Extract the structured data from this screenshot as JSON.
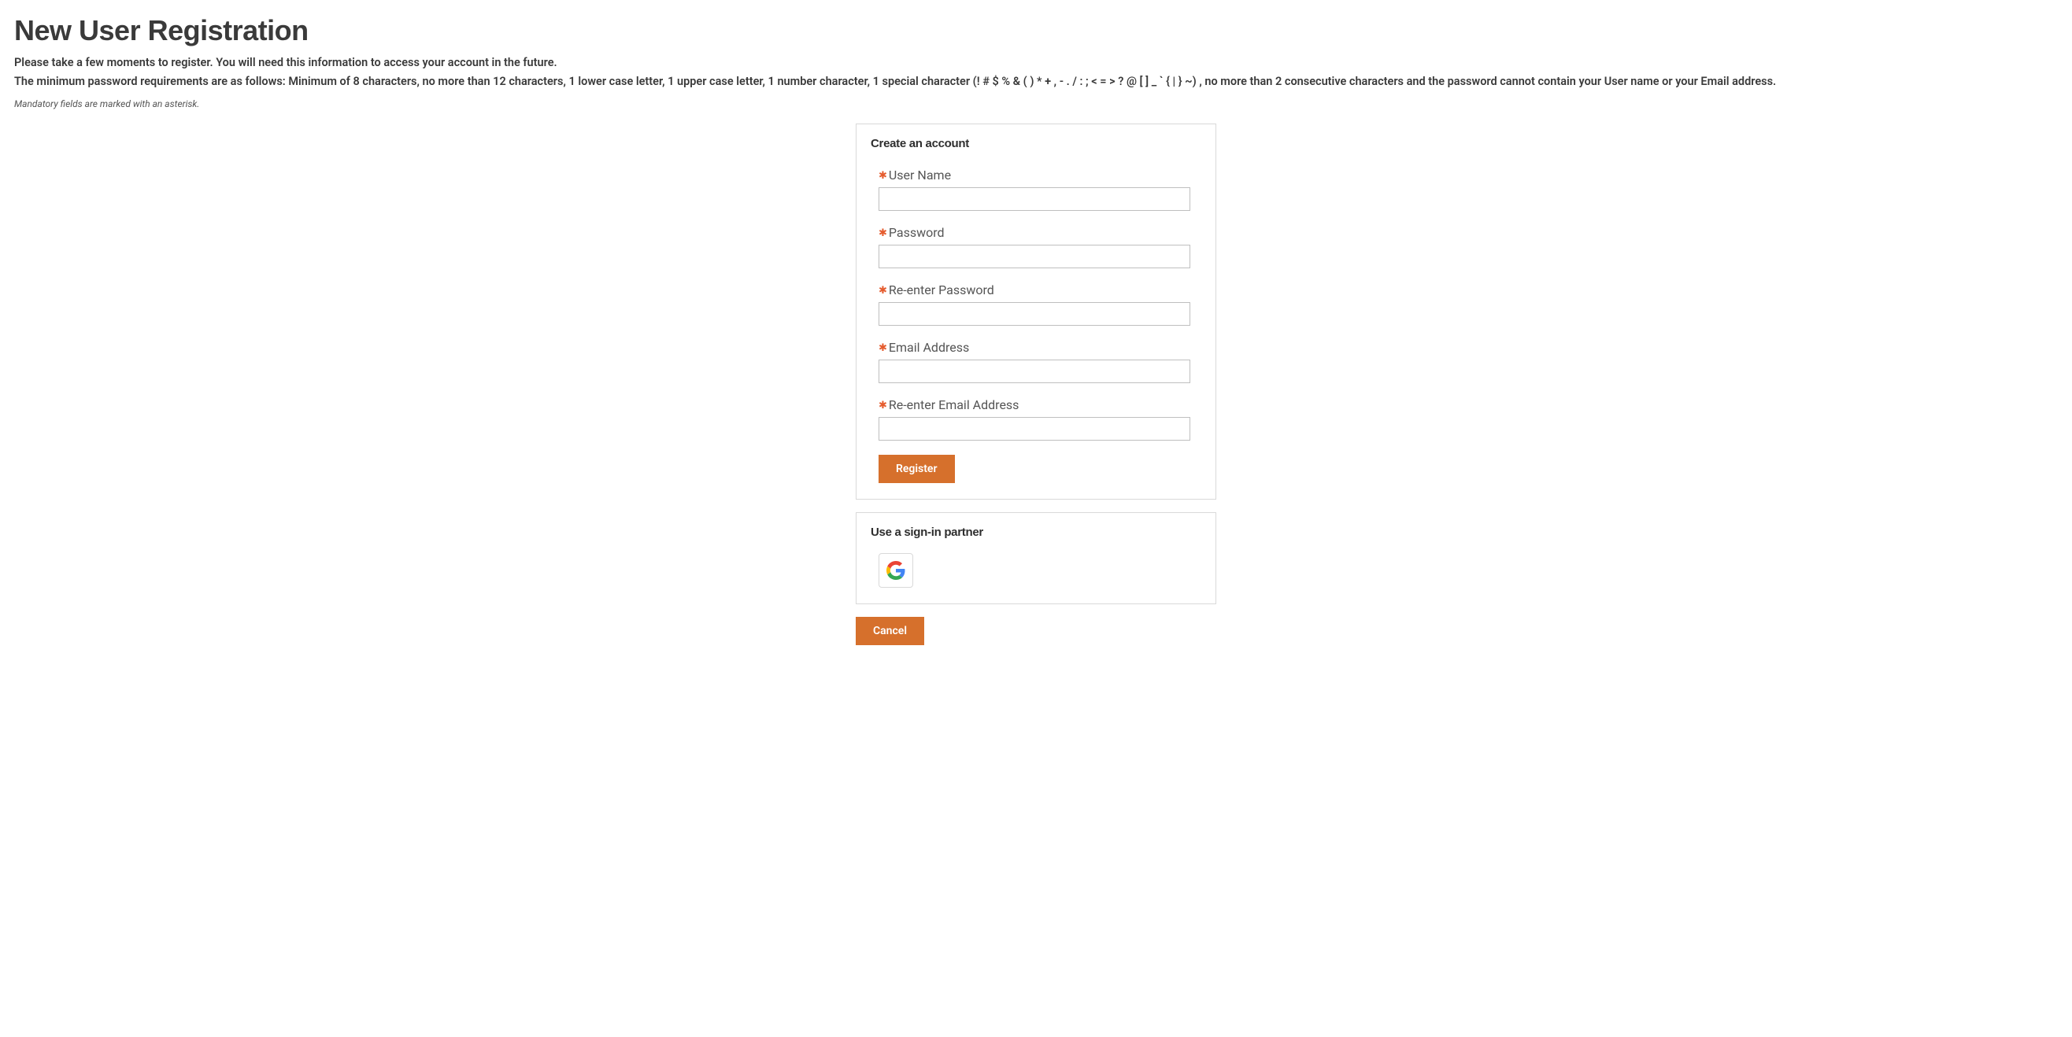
{
  "page": {
    "title": "New User Registration",
    "intro1": "Please take a few moments to register. You will need this information to access your account in the future.",
    "intro2": "The minimum password requirements are as follows: Minimum of 8 characters, no more than 12 characters, 1 lower case letter, 1 upper case letter, 1 number character, 1 special character (! # $ % & ( ) * + , - . / : ; < = > ? @ [ ] _ ` { | } ~) , no more than 2 consecutive characters and the password cannot contain your User name or your Email address.",
    "mandatory_note": "Mandatory fields are marked with an asterisk."
  },
  "form": {
    "card_title": "Create an account",
    "fields": {
      "username": {
        "label": "User Name",
        "value": ""
      },
      "password": {
        "label": "Password",
        "value": ""
      },
      "password2": {
        "label": "Re-enter Password",
        "value": ""
      },
      "email": {
        "label": "Email Address",
        "value": ""
      },
      "email2": {
        "label": "Re-enter Email Address",
        "value": ""
      }
    },
    "register_label": "Register"
  },
  "partner": {
    "card_title": "Use a sign-in partner",
    "google_name": "google-signin"
  },
  "cancel_label": "Cancel",
  "required_marker": "✱"
}
